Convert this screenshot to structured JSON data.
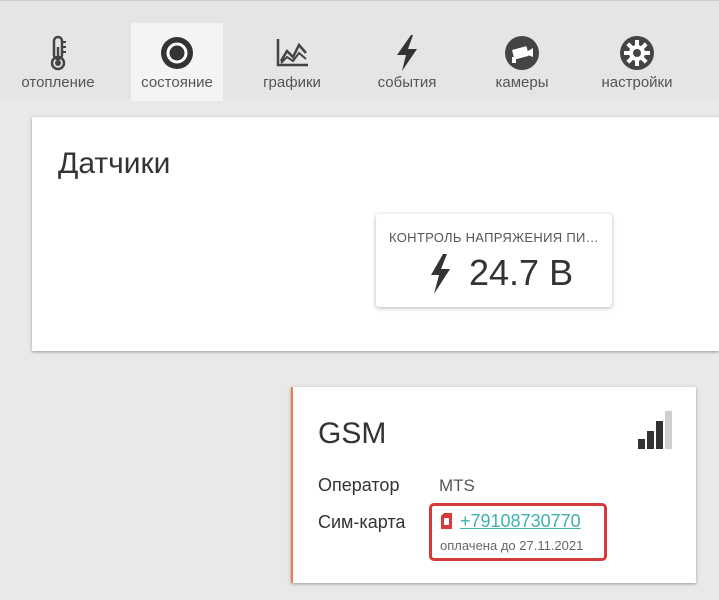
{
  "nav": {
    "tabs": [
      {
        "label": "отопление",
        "icon": "thermometer-icon"
      },
      {
        "label": "состояние",
        "icon": "status-circle-icon",
        "active": true
      },
      {
        "label": "графики",
        "icon": "chart-icon"
      },
      {
        "label": "события",
        "icon": "lightning-icon"
      },
      {
        "label": "камеры",
        "icon": "camera-icon"
      },
      {
        "label": "настройки",
        "icon": "gear-icon"
      }
    ]
  },
  "sensors": {
    "title": "Датчики",
    "card": {
      "name": "КОНТРОЛЬ НАПРЯЖЕНИЯ ПИТАНИЯ",
      "value": "24.7 В",
      "icon": "lightning-icon"
    }
  },
  "gsm": {
    "title": "GSM",
    "signal_bars_filled": 3,
    "signal_bars_total": 4,
    "operator_label": "Оператор",
    "operator_value": "MTS",
    "sim_label": "Сим-карта",
    "sim_number": "+79108730770",
    "sim_paid": "оплачена до 27.11.2021"
  },
  "colors": {
    "accent": "#f07c4a",
    "link": "#3fb1b0",
    "highlight": "#d63a3a",
    "sim_icon": "#d63a3a"
  }
}
